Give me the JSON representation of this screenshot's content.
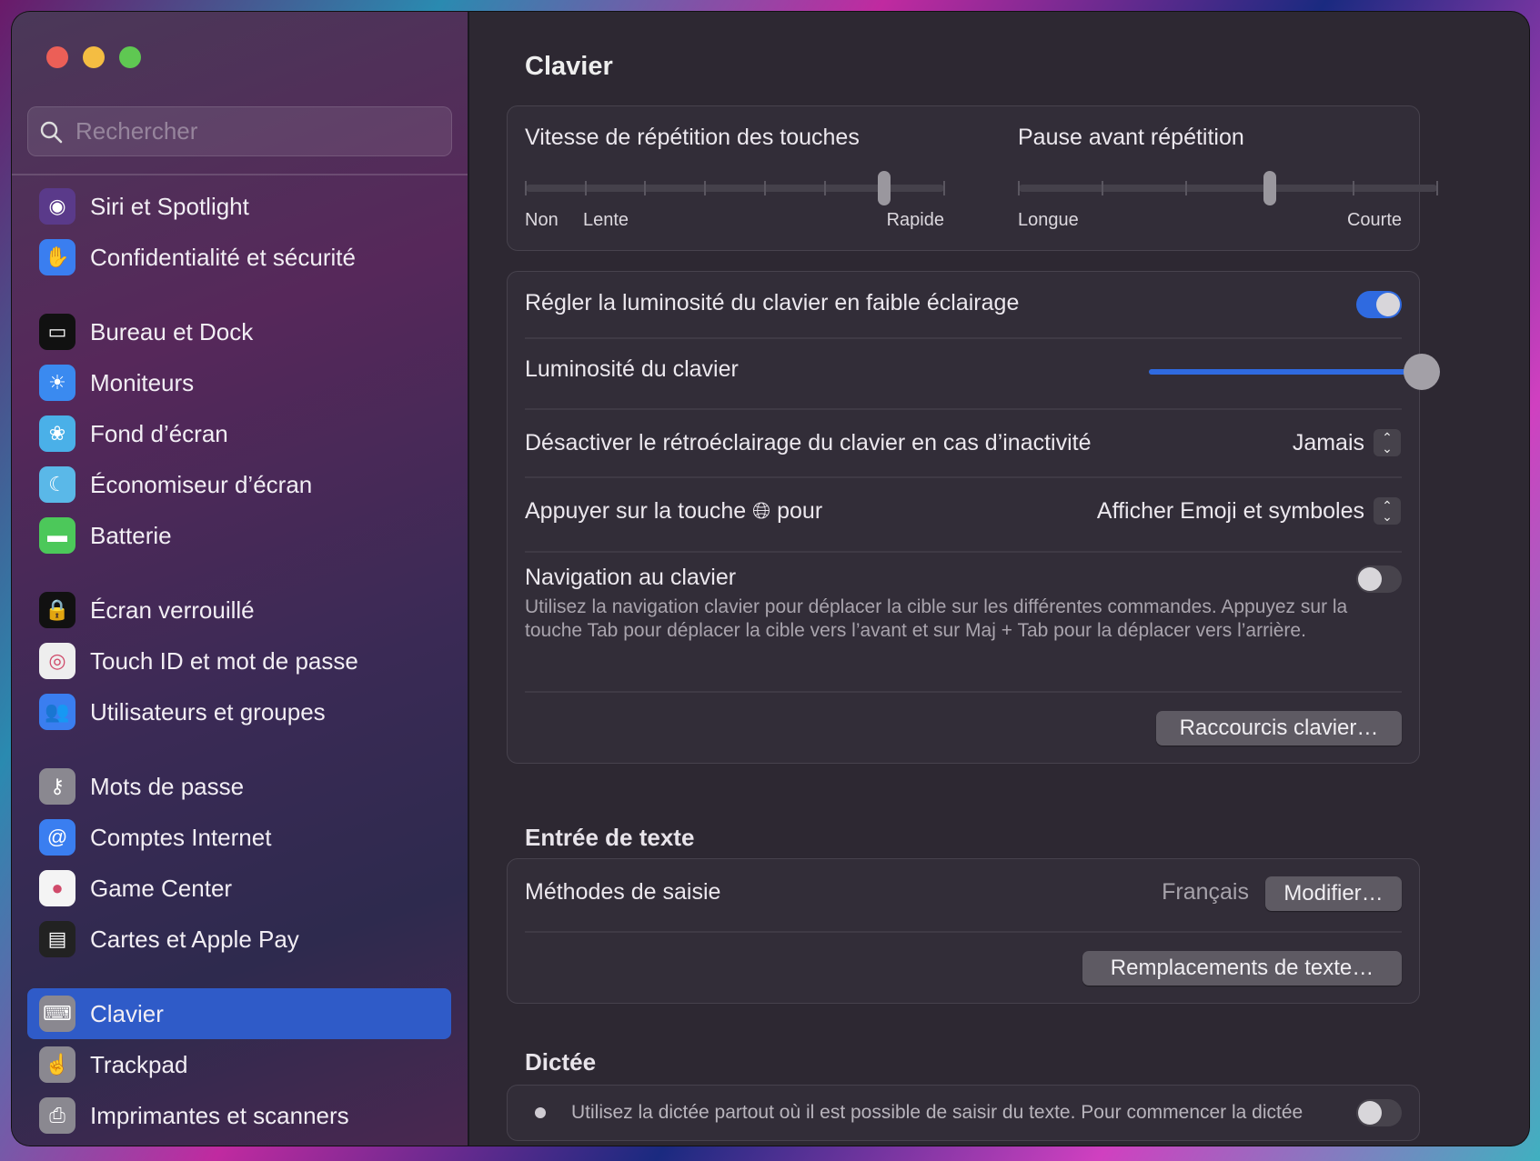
{
  "search": {
    "placeholder": "Rechercher"
  },
  "sidebar": {
    "groups": [
      [
        {
          "label": "Siri et Spotlight",
          "icon": "siri-icon",
          "color": "#5a3a8a",
          "glyph": "◉"
        },
        {
          "label": "Confidentialité et sécurité",
          "icon": "hand-icon",
          "color": "#3a7ef0",
          "glyph": "✋"
        }
      ],
      [
        {
          "label": "Bureau et Dock",
          "icon": "dock-icon",
          "color": "#111111",
          "glyph": "▭"
        },
        {
          "label": "Moniteurs",
          "icon": "sun-icon",
          "color": "#3a8af0",
          "glyph": "☀"
        },
        {
          "label": "Fond d’écran",
          "icon": "flower-icon",
          "color": "#4ab0e8",
          "glyph": "❀"
        },
        {
          "label": "Économiseur d’écran",
          "icon": "screensaver-icon",
          "color": "#5ab8e8",
          "glyph": "☾"
        },
        {
          "label": "Batterie",
          "icon": "battery-icon",
          "color": "#4cc85a",
          "glyph": "▬"
        }
      ],
      [
        {
          "label": "Écran verrouillé",
          "icon": "lock-icon",
          "color": "#111111",
          "glyph": "🔒"
        },
        {
          "label": "Touch ID et mot de passe",
          "icon": "fingerprint-icon",
          "color": "#eeeeee",
          "glyph": "◎"
        },
        {
          "label": "Utilisateurs et groupes",
          "icon": "users-icon",
          "color": "#3a7ef0",
          "glyph": "👥"
        }
      ],
      [
        {
          "label": "Mots de passe",
          "icon": "key-icon",
          "color": "#8a8890",
          "glyph": "⚷"
        },
        {
          "label": "Comptes Internet",
          "icon": "at-icon",
          "color": "#3a7ef0",
          "glyph": "@"
        },
        {
          "label": "Game Center",
          "icon": "game-center-icon",
          "color": "#f4f4f4",
          "glyph": "●"
        },
        {
          "label": "Cartes et Apple Pay",
          "icon": "wallet-icon",
          "color": "#222222",
          "glyph": "▤"
        }
      ],
      [
        {
          "label": "Clavier",
          "icon": "keyboard-icon",
          "color": "#8a8890",
          "glyph": "⌨",
          "selected": true
        },
        {
          "label": "Trackpad",
          "icon": "trackpad-icon",
          "color": "#8a8890",
          "glyph": "☝"
        },
        {
          "label": "Imprimantes et scanners",
          "icon": "printer-icon",
          "color": "#8a8890",
          "glyph": "⎙"
        }
      ]
    ]
  },
  "main": {
    "title": "Clavier",
    "key_repeat": {
      "label": "Vitesse de répétition des touches",
      "labels": [
        "Non",
        "Lente",
        "Rapide"
      ],
      "ticks": 8,
      "value_index": 6
    },
    "delay": {
      "label": "Pause avant répétition",
      "labels": [
        "Longue",
        "Courte"
      ],
      "ticks": 6,
      "value_index": 3
    },
    "auto_brightness": {
      "label": "Régler la luminosité du clavier en faible éclairage",
      "on": true
    },
    "brightness": {
      "label": "Luminosité du clavier",
      "value": 1.0
    },
    "backlight_off": {
      "label": "Désactiver le rétroéclairage du clavier en cas d’inactivité",
      "value": "Jamais"
    },
    "globe_key": {
      "label_pre": "Appuyer sur la touche",
      "label_post": "pour",
      "value": "Afficher Emoji et symboles"
    },
    "keyboard_nav": {
      "label": "Navigation au clavier",
      "desc": "Utilisez la navigation clavier pour déplacer la cible sur les différentes commandes. Appuyez sur la touche Tab pour déplacer la cible vers l’avant et sur Maj + Tab pour la déplacer vers l’arrière.",
      "on": false
    },
    "shortcuts_button": "Raccourcis clavier…",
    "text_input": {
      "heading": "Entrée de texte",
      "methods_label": "Méthodes de saisie",
      "methods_value": "Français",
      "modify_button": "Modifier…",
      "replacements_button": "Remplacements de texte…"
    },
    "dictation": {
      "heading": "Dictée",
      "desc": "Utilisez la dictée partout où il est possible de saisir du texte. Pour commencer la dictée",
      "on": false
    }
  }
}
